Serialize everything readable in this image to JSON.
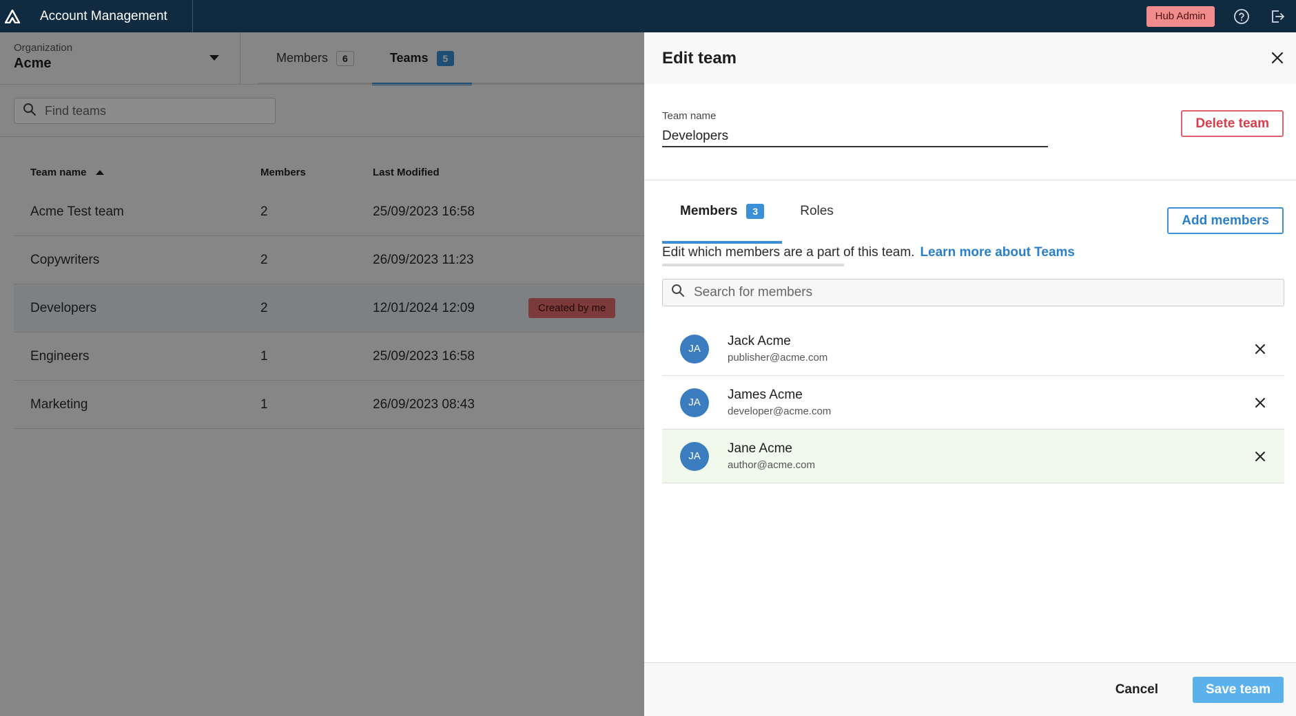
{
  "app": {
    "title": "Account Management"
  },
  "topbar": {
    "role_badge": "Hub Admin",
    "help_icon": "help-icon",
    "logout_icon": "logout-icon"
  },
  "organization": {
    "label": "Organization",
    "value": "Acme"
  },
  "tabs": [
    {
      "label": "Members",
      "count": "6"
    },
    {
      "label": "Teams",
      "count": "5"
    }
  ],
  "search": {
    "placeholder": "Find teams"
  },
  "table": {
    "headers": {
      "name": "Team name",
      "members": "Members",
      "modified": "Last Modified"
    },
    "rows": [
      {
        "name": "Acme Test team",
        "members": "2",
        "modified": "25/09/2023 16:58",
        "badge": ""
      },
      {
        "name": "Copywriters",
        "members": "2",
        "modified": "26/09/2023 11:23",
        "badge": ""
      },
      {
        "name": "Developers",
        "members": "2",
        "modified": "12/01/2024 12:09",
        "badge": "Created by me"
      },
      {
        "name": "Engineers",
        "members": "1",
        "modified": "25/09/2023 16:58",
        "badge": ""
      },
      {
        "name": "Marketing",
        "members": "1",
        "modified": "26/09/2023 08:43",
        "badge": ""
      }
    ]
  },
  "panel": {
    "title": "Edit team",
    "team_name_label": "Team name",
    "team_name_value": "Developers",
    "delete_label": "Delete team",
    "tabs": [
      {
        "label": "Members",
        "count": "3"
      },
      {
        "label": "Roles"
      }
    ],
    "add_members_label": "Add members",
    "description": "Edit which members are a part of this team.",
    "learn_more": "Learn more about Teams",
    "member_search_placeholder": "Search for members",
    "members": [
      {
        "initials": "JA",
        "name": "Jack Acme",
        "email": "publisher@acme.com"
      },
      {
        "initials": "JA",
        "name": "James Acme",
        "email": "developer@acme.com"
      },
      {
        "initials": "JA",
        "name": "Jane Acme",
        "email": "author@acme.com"
      }
    ],
    "cancel_label": "Cancel",
    "save_label": "Save team"
  },
  "colors": {
    "topbar": "#102a40",
    "accent": "#3a8fd6",
    "danger": "#d93d4b",
    "badge": "#e46a6a"
  }
}
